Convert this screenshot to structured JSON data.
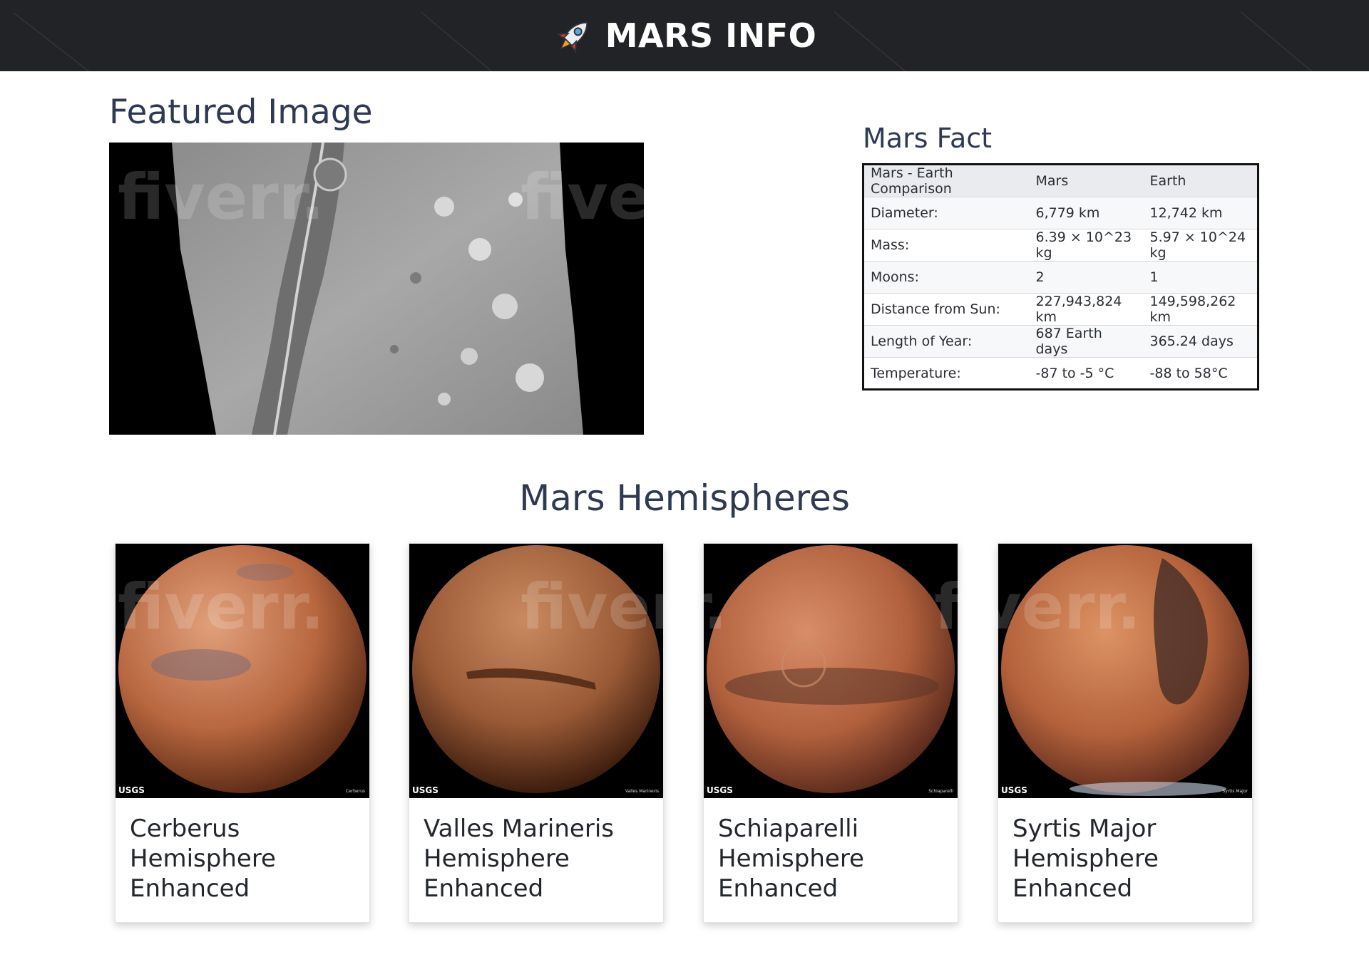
{
  "header": {
    "title": "MARS INFO",
    "logo_icon": "rocket-icon"
  },
  "featured": {
    "title": "Featured Image"
  },
  "facts": {
    "title": "Mars Fact",
    "columns": [
      "Mars - Earth Comparison",
      "Mars",
      "Earth"
    ],
    "rows": [
      [
        "Diameter:",
        "6,779 km",
        "12,742 km"
      ],
      [
        "Mass:",
        "6.39 × 10^23 kg",
        "5.97 × 10^24 kg"
      ],
      [
        "Moons:",
        "2",
        "1"
      ],
      [
        "Distance from Sun:",
        "227,943,824 km",
        "149,598,262 km"
      ],
      [
        "Length of Year:",
        "687 Earth days",
        "365.24 days"
      ],
      [
        "Temperature:",
        "-87 to -5 °C",
        "-88 to 58°C"
      ]
    ]
  },
  "hemispheres": {
    "title": "Mars Hemispheres",
    "logo_text": "USGS",
    "items": [
      {
        "title": "Cerberus Hemisphere Enhanced",
        "caption": "Cerberus"
      },
      {
        "title": "Valles Marineris Hemisphere Enhanced",
        "caption": "Valles Marineris"
      },
      {
        "title": "Schiaparelli Hemisphere Enhanced",
        "caption": "Schiaparelli"
      },
      {
        "title": "Syrtis Major Hemisphere Enhanced",
        "caption": "Syrtis Major"
      }
    ]
  },
  "watermark": {
    "text": "fiverr."
  },
  "colors": {
    "header_bg": "#222326",
    "heading": "#2f3a52",
    "table_border": "#111111",
    "mars": "#b8603e"
  }
}
